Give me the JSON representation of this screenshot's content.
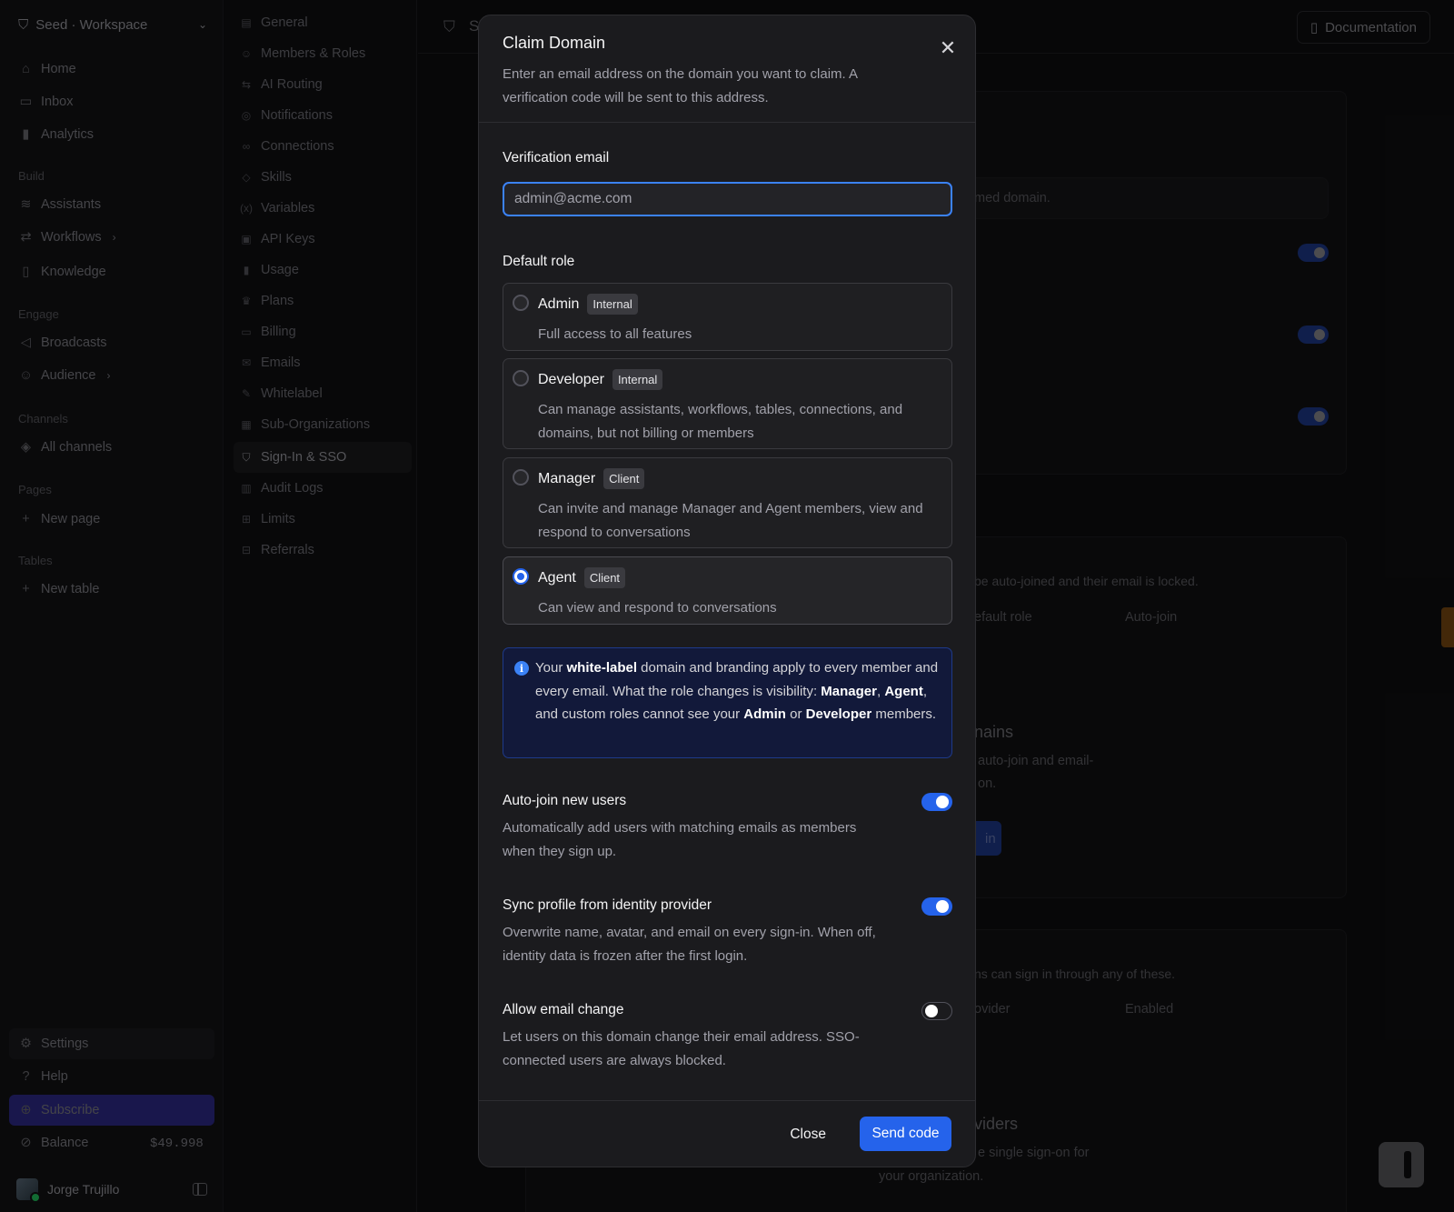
{
  "workspace": {
    "name": "Seed · Workspace"
  },
  "sidebar": {
    "items": [
      {
        "label": "Home",
        "icon": "home-icon"
      },
      {
        "label": "Inbox",
        "icon": "inbox-icon"
      },
      {
        "label": "Analytics",
        "icon": "analytics-icon"
      }
    ],
    "sections": {
      "build": "Build",
      "engage": "Engage",
      "channels": "Channels",
      "pages": "Pages",
      "tables": "Tables"
    },
    "build_items": [
      {
        "label": "Assistants",
        "icon": "waveform-icon"
      },
      {
        "label": "Workflows",
        "icon": "workflow-icon"
      },
      {
        "label": "Knowledge",
        "icon": "book-icon"
      }
    ],
    "engage_items": [
      {
        "label": "Broadcasts",
        "icon": "megaphone-icon"
      },
      {
        "label": "Audience",
        "icon": "users-icon"
      }
    ],
    "channels_items": [
      {
        "label": "All channels",
        "icon": "layers-icon"
      }
    ],
    "pages_new": "New page",
    "tables_new": "New table",
    "settings": "Settings",
    "help": "Help",
    "subscribe": "Subscribe",
    "balance_label": "Balance",
    "balance_value": "$49.998",
    "user_name": "Jorge Trujillo"
  },
  "subnav": {
    "items": [
      "General",
      "Members & Roles",
      "AI Routing",
      "Notifications",
      "Connections",
      "Skills",
      "Variables",
      "API Keys",
      "Usage",
      "Plans",
      "Billing",
      "Emails",
      "Whitelabel",
      "Sub-Organizations",
      "Sign-In & SSO",
      "Audit Logs",
      "Limits",
      "Referrals"
    ],
    "active": "Sign-In & SSO"
  },
  "topbar": {
    "page_title_fragment": "S",
    "documentation": "Documentation"
  },
  "background": {
    "claimed_domain_fragment": "med domain.",
    "autojoin_fragment": "be auto-joined and their email is locked.",
    "col_default_role": "efault role",
    "col_auto_join": "Auto-join",
    "domains_heading_fragment": "nains",
    "domains_desc_1": "auto-join and email-",
    "domains_desc_2": "on.",
    "domains_btn_fragment": "in",
    "signin_fragment": "ns can sign in through any of these.",
    "col_provider": "ovider",
    "col_enabled": "Enabled",
    "providers_fragment": "viders",
    "sso_desc_1": "e single sign-on for",
    "sso_desc_2": "your organization."
  },
  "modal": {
    "title": "Claim Domain",
    "description": "Enter an email address on the domain you want to claim. A verification code will be sent to this address.",
    "email_label": "Verification email",
    "email_value": "admin@acme.com",
    "role_label": "Default role",
    "roles": [
      {
        "name": "Admin",
        "badge": "Internal",
        "description": "Full access to all features",
        "selected": false
      },
      {
        "name": "Developer",
        "badge": "Internal",
        "description": "Can manage assistants, workflows, tables, connections, and domains, but not billing or members",
        "selected": false
      },
      {
        "name": "Manager",
        "badge": "Client",
        "description": "Can invite and manage Manager and Agent members, view and respond to conversations",
        "selected": false
      },
      {
        "name": "Agent",
        "badge": "Client",
        "description": "Can view and respond to conversations",
        "selected": true
      }
    ],
    "info": {
      "t1": "Your ",
      "b1": "white-label",
      "t2": " domain and branding apply to every member and every email. What the role changes is visibility: ",
      "b2": "Manager",
      "t3": ", ",
      "b3": "Agent",
      "t4": ", and custom roles cannot see your ",
      "b4": "Admin",
      "t5": " or ",
      "b5": "Developer",
      "t6": " members."
    },
    "options": [
      {
        "title": "Auto-join new users",
        "description": "Automatically add users with matching emails as members when they sign up.",
        "enabled": true
      },
      {
        "title": "Sync profile from identity provider",
        "description": "Overwrite name, avatar, and email on every sign-in. When off, identity data is frozen after the first login.",
        "enabled": true
      },
      {
        "title": "Allow email change",
        "description": "Let users on this domain change their email address. SSO-connected users are always blocked.",
        "enabled": false
      }
    ],
    "close_label": "Close",
    "send_label": "Send code"
  },
  "colors": {
    "accent": "#2563eb",
    "focus_ring": "#3b82f6",
    "info_bg": "#12193a",
    "subscribe": "#2e2a8a"
  }
}
